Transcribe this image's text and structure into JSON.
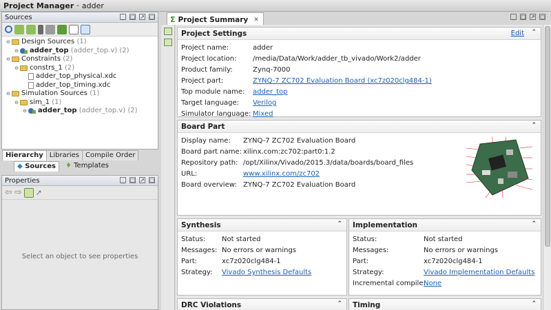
{
  "window": {
    "title": "Project Manager",
    "separator": "-",
    "project": "adder"
  },
  "sources_panel": {
    "title": "Sources",
    "tree": [
      {
        "label": "Design Sources",
        "count": "(1)"
      },
      {
        "label": "adder_top",
        "file": "(adder_top.v) (2)"
      },
      {
        "label": "Constraints",
        "count": "(2)"
      },
      {
        "label": "constrs_1",
        "count": "(2)"
      },
      {
        "label": "adder_top_physical.xdc"
      },
      {
        "label": "adder_top_timing.xdc"
      },
      {
        "label": "Simulation Sources",
        "count": "(1)"
      },
      {
        "label": "sim_1",
        "count": "(1)"
      },
      {
        "label": "adder_top",
        "file": "(adder_top.v) (2)"
      }
    ],
    "tabs": [
      "Hierarchy",
      "Libraries",
      "Compile Order"
    ],
    "subtabs": [
      "Sources",
      "Templates"
    ]
  },
  "properties_panel": {
    "title": "Properties",
    "message": "Select an object to see properties"
  },
  "main_tab": {
    "label": "Project Summary"
  },
  "project_settings": {
    "title": "Project Settings",
    "edit": "Edit",
    "rows": [
      {
        "k": "Project name:",
        "v": "adder"
      },
      {
        "k": "Project location:",
        "v": "/media/Data/Work/adder_tb_vivado/Work2/adder"
      },
      {
        "k": "Product family:",
        "v": "Zynq-7000"
      },
      {
        "k": "Project part:",
        "v": "ZYNQ-7 ZC702 Evaluation Board (xc7z020clg484-1)"
      },
      {
        "k": "Top module name:",
        "v": "adder_top"
      },
      {
        "k": "Target language:",
        "v": "Verilog"
      },
      {
        "k": "Simulator language:",
        "v": "Mixed"
      }
    ]
  },
  "board_part": {
    "title": "Board Part",
    "rows": [
      {
        "k": "Display name:",
        "v": "ZYNQ-7 ZC702 Evaluation Board"
      },
      {
        "k": "Board part name:",
        "v": "xilinx.com:zc702:part0:1.2"
      },
      {
        "k": "Repository path:",
        "v": "/opt/Xilinx/Vivado/2015.3/data/boards/board_files"
      },
      {
        "k": "URL:",
        "v": "www.xilinx.com/zc702"
      },
      {
        "k": "Board overview:",
        "v": "ZYNQ-7 ZC702 Evaluation Board"
      }
    ]
  },
  "synthesis": {
    "title": "Synthesis",
    "rows": [
      {
        "k": "Status:",
        "v": "Not started"
      },
      {
        "k": "Messages:",
        "v": "No errors or warnings"
      },
      {
        "k": "Part:",
        "v": "xc7z020clg484-1"
      },
      {
        "k": "Strategy:",
        "v": "Vivado Synthesis Defaults"
      }
    ]
  },
  "implementation": {
    "title": "Implementation",
    "rows": [
      {
        "k": "Status:",
        "v": "Not started"
      },
      {
        "k": "Messages:",
        "v": "No errors or warnings"
      },
      {
        "k": "Part:",
        "v": "xc7z020clg484-1"
      },
      {
        "k": "Strategy:",
        "v": "Vivado Implementation Defaults"
      },
      {
        "k": "Incremental compile:",
        "v": "None"
      }
    ]
  },
  "drc": {
    "title": "DRC Violations"
  },
  "timing": {
    "title": "Timing"
  },
  "collapse_glyph": "⌃",
  "colors": {
    "link": "#1a5fb4",
    "folder": "#e6c35a"
  }
}
